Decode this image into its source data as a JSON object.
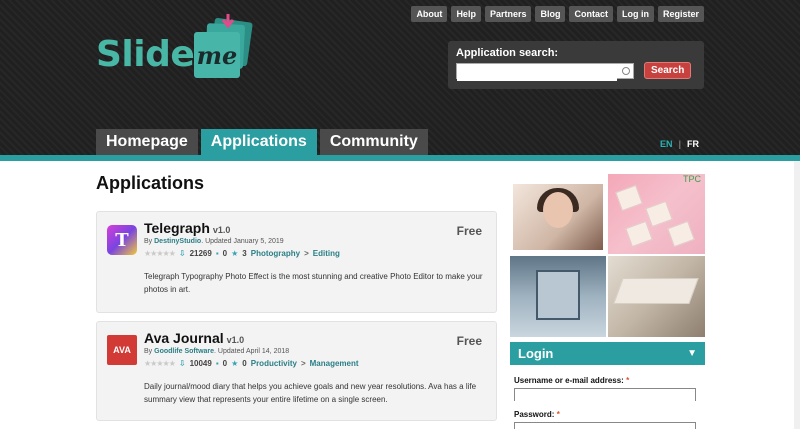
{
  "logo": {
    "text": "Slide",
    "badge": "me"
  },
  "top_nav": [
    "About",
    "Help",
    "Partners",
    "Blog",
    "Contact",
    "Log in",
    "Register"
  ],
  "search": {
    "label": "Application search:",
    "value": "",
    "placeholder": "",
    "button": "Search"
  },
  "main_tabs": [
    {
      "label": "Homepage",
      "active": false
    },
    {
      "label": "Applications",
      "active": true
    },
    {
      "label": "Community",
      "active": false
    }
  ],
  "lang": {
    "en": "EN",
    "fr": "FR"
  },
  "page_title": "Applications",
  "apps": [
    {
      "name": "Telegraph",
      "version": "v1.0",
      "price": "Free",
      "by_prefix": "By",
      "author": "DestinyStudio",
      "updated": ". Updated January 5, 2019",
      "downloads": "21269",
      "comments": "0",
      "rating_count": "3",
      "categories": [
        "Photography",
        "Editing"
      ],
      "description": "Telegraph Typography Photo Effect is the most stunning and creative Photo Editor to make your photos in art.",
      "icon_letter": "T"
    },
    {
      "name": "Ava Journal",
      "version": "v1.0",
      "price": "Free",
      "by_prefix": "By",
      "author": "Goodlife Software",
      "updated": ". Updated April 14, 2018",
      "downloads": "10049",
      "comments": "0",
      "rating_count": "0",
      "categories": [
        "Productivity",
        "Management"
      ],
      "description": "Daily journal/mood diary that helps you achieve goals and new year resolutions. Ava has a life summary view that represents your entire lifetime on a single screen.",
      "icon_letter": "AVA"
    }
  ],
  "ad_labels": {
    "i2_corner": "TPC"
  },
  "login": {
    "title": "Login",
    "username_label": "Username or e-mail address:",
    "password_label": "Password:",
    "required_mark": "*",
    "username_value": "",
    "password_value": ""
  },
  "colors": {
    "accent": "#2a9ea0",
    "search_button": "#c7423f",
    "header_bg": "#202020"
  },
  "icons": {
    "downloads": "download-icon",
    "comments": "comment-icon",
    "rating": "star-icon",
    "login_toggle": "triangle-down-icon"
  }
}
